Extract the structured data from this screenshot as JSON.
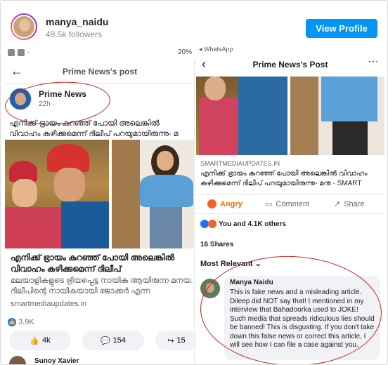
{
  "instagram": {
    "username": "manya_naidu",
    "followers": "49.5k followers",
    "view_profile": "View Profile"
  },
  "left": {
    "status_right": "20%",
    "nav_title": "Prime News's post",
    "page_name": "Prime News",
    "time": "22h ·",
    "post_text": "എനിക്ക് ഭ്രായം കുറഞ്ഞ് പോയി അലെങ്കിൽ വിവാഹം കഴിക്കുമെന്ന് ദിലീപ് പറയുമായിരുന്നു- മ",
    "caption_title": "എനിക്ക് ഭ്രായം കുറഞ്ഞ് പോയി അലെങ്കിൽ വിവാഹം കഴിക്കുമെന്ന് ദിലീപ്",
    "caption_sub": "മലയാളികളുടെ ഭ്രിയപ്പെട്ട നായിക ആയിരുന്ന മനയ. ദിലീപിന്റെ നായികയായി ജോക്കർ എന്ന",
    "domain": "smartmediaupdates.in",
    "reactions": "3.9K",
    "like_count": "4k",
    "comment_count": "154",
    "share_count": "15",
    "next_commenter": "Sunoy Xavier"
  },
  "right": {
    "whatsapp": "◂ WhatsApp",
    "nav_title": "Prime News's Post",
    "domain": "SMARTMEDIAUPDATES.IN",
    "text": "എനിക്ക് ഭ്രായം കുറഞ്ഞ് പോയി അലെങ്കിൽ വിവാഹം കഴിക്കുമെന്ന് ദിലീപ് പറയുമായിരുന്നു- മനു - SMART",
    "angry": "Angry",
    "comment": "Comment",
    "share": "Share",
    "reactions": "You and 4.1K others",
    "shares": "16 Shares",
    "most_relevant": "Most Relevant ⌄",
    "commenter": "Manya Naidu",
    "comment_text": "This is fake news and a misleading article. Dileep did NOT say that! I mentioned in my interview that Bahadoorka used to JOKE! Such media that spreads ridiculous lies should be banned! This is disgusting. If you don't take down this false news or correct this article, I will see how I can file a case against you."
  },
  "colors": {
    "accent": "#0095f6",
    "annotation": "#c8211c",
    "fb_blue": "#1877f2",
    "angry": "#e9710f"
  }
}
